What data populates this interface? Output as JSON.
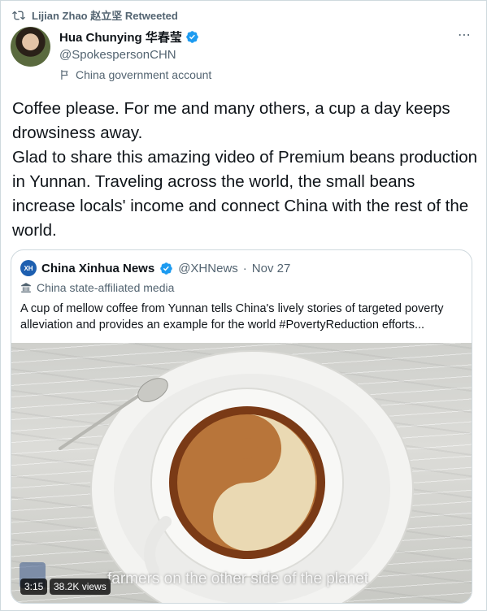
{
  "retweet": {
    "icon": "retweet-icon",
    "label": "Lijian Zhao 赵立坚 Retweeted"
  },
  "author": {
    "name": "Hua Chunying 华春莹",
    "handle": "@SpokespersonCHN",
    "label": "China government account",
    "verified_color": "#1d9bf0"
  },
  "tweet": {
    "lines": [
      "Coffee please. For me and many others, a cup a day keeps drowsiness away.",
      "Glad to share this amazing video of Premium beans production in Yunnan. Traveling across the world, the small beans increase locals' income and connect China with the rest of the world."
    ]
  },
  "more": {
    "label": "⋯"
  },
  "quote": {
    "name": "China Xinhua News",
    "handle": "@XHNews",
    "separator": "·",
    "date": "Nov 27",
    "label": "China state-affiliated media",
    "text": "A cup of mellow coffee from Yunnan tells China's lively stories of targeted poverty alleviation and provides an example for the world #PovertyReduction efforts...",
    "media": {
      "subtitle": "farmers on the other side of the planet",
      "duration": "3:15",
      "views": "38.2K views"
    }
  },
  "colors": {
    "text": "#0f1419",
    "secondary": "#536471",
    "border": "#cfd9de"
  }
}
